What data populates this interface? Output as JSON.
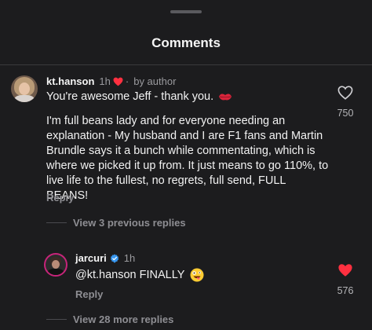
{
  "sheet": {
    "title": "Comments"
  },
  "comment": {
    "username": "kt.hanson",
    "time": "1h",
    "dot": "·",
    "author_badge": "by author",
    "paragraph1": "You're awesome Jeff - thank you.",
    "paragraph2": "I'm full beans lady and for everyone needing an explanation - My husband and I are F1 fans and Martin Brundle says it a bunch while commentating, which is where we picked it up from. It just means to go 110%, to live life to the fullest, no regrets, full send, FULL BEANS!",
    "like_count": "750",
    "reply_label": "Reply",
    "view_previous": "View 3 previous replies"
  },
  "reply": {
    "username": "jarcuri",
    "time": "1h",
    "text": "@kt.hanson FINALLY",
    "like_count": "576",
    "reply_label": "Reply",
    "liked": true
  },
  "view_more": "View 28 more replies",
  "icons": {
    "liked_color": "#ff3040",
    "verified_color": "#3797f0",
    "author_heart_color": "#ff3040"
  }
}
